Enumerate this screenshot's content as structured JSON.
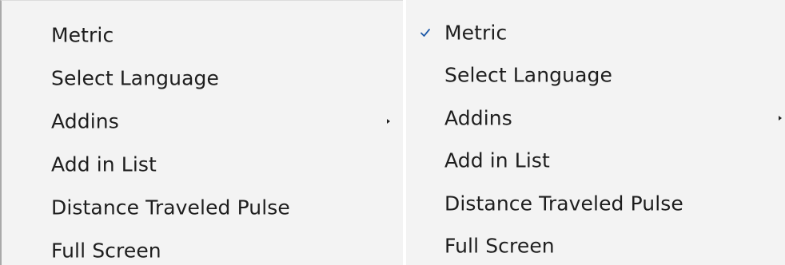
{
  "menus": {
    "left": {
      "items": [
        {
          "label": "Metric",
          "checked": false,
          "has_submenu": false
        },
        {
          "label": "Select Language",
          "checked": false,
          "has_submenu": false
        },
        {
          "label": "Addins",
          "checked": false,
          "has_submenu": true
        },
        {
          "label": "Add in List",
          "checked": false,
          "has_submenu": false
        },
        {
          "label": "Distance Traveled Pulse",
          "checked": false,
          "has_submenu": false
        },
        {
          "label": "Full Screen",
          "checked": false,
          "has_submenu": false
        }
      ]
    },
    "right": {
      "items": [
        {
          "label": "Metric",
          "checked": true,
          "has_submenu": false
        },
        {
          "label": "Select Language",
          "checked": false,
          "has_submenu": false
        },
        {
          "label": "Addins",
          "checked": false,
          "has_submenu": true
        },
        {
          "label": "Add in List",
          "checked": false,
          "has_submenu": false
        },
        {
          "label": "Distance Traveled Pulse",
          "checked": false,
          "has_submenu": false
        },
        {
          "label": "Full Screen",
          "checked": false,
          "has_submenu": false
        }
      ]
    }
  },
  "colors": {
    "menu_background": "#f3f3f3",
    "text": "#1e1e1e",
    "checkmark": "#1f5aa8"
  },
  "icons": {
    "checkmark": "checkmark-icon",
    "submenu_arrow": "submenu-arrow-icon"
  }
}
